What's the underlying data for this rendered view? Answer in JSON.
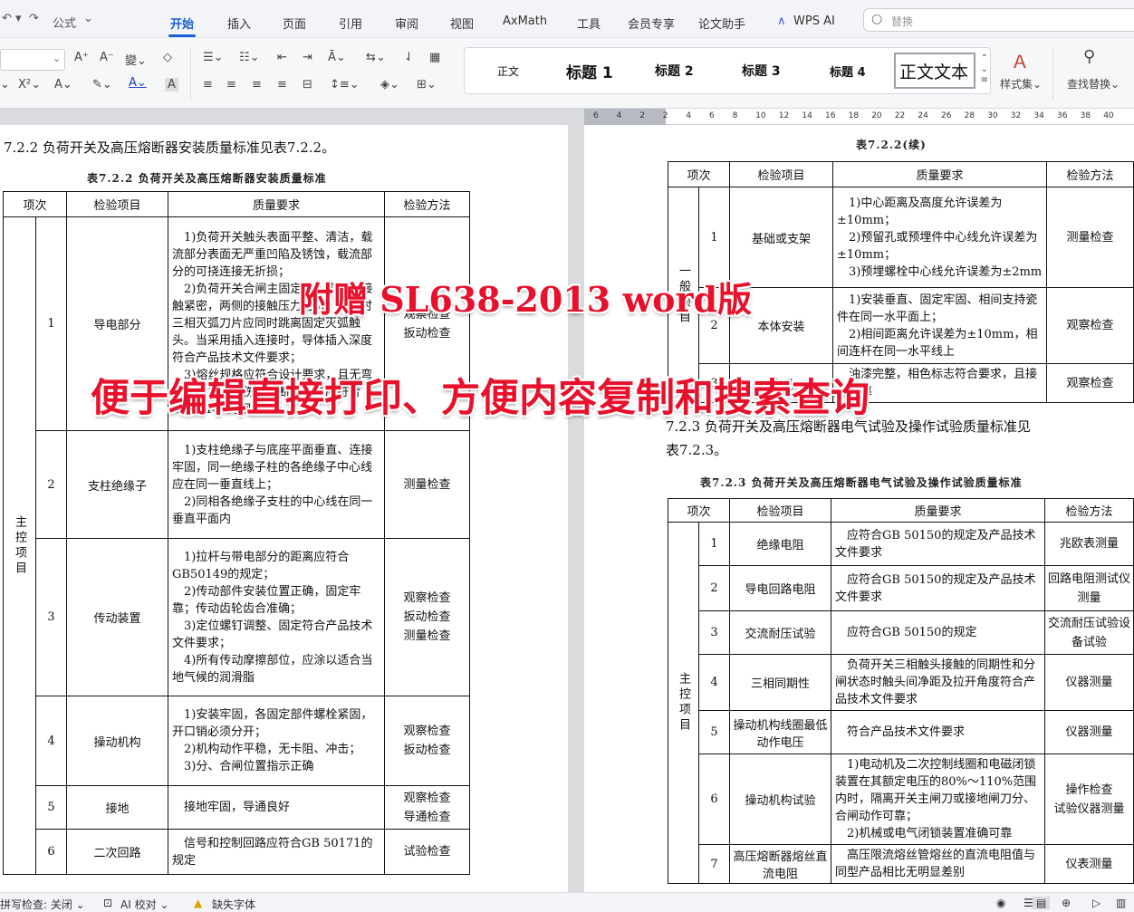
{
  "quick_access": {
    "undo_label": "公式"
  },
  "tabs": [
    "开始",
    "插入",
    "页面",
    "引用",
    "审阅",
    "视图",
    "AxMath",
    "工具",
    "会员专享",
    "论文助手",
    "WPS AI"
  ],
  "search": {
    "placeholder": "替换"
  },
  "ribbon": {
    "styles": [
      "正文",
      "标题 1",
      "标题 2",
      "标题 3",
      "标题 4",
      "正文文本"
    ],
    "style_set_label": "样式集",
    "find_replace_label": "查找替换"
  },
  "ruler": {
    "ticks": [
      "6",
      "4",
      "2",
      "2",
      "4",
      "6",
      "8",
      "10",
      "12",
      "14",
      "16",
      "18",
      "20",
      "22",
      "24",
      "26",
      "28",
      "30",
      "32",
      "34",
      "36",
      "38",
      "40"
    ]
  },
  "page1": {
    "section_heading": "7.2.2    负荷开关及高压熔断器安装质量标准见表7.2.2。",
    "table_caption": "表7.2.2   负荷开关及高压熔断器安装质量标准",
    "headers": [
      "项次",
      "检验项目",
      "质量要求",
      "检验方法"
    ],
    "group_label": "主控项目",
    "rows": [
      {
        "no": "1",
        "item": "导电部分",
        "req": [
          "1)负荷开关触头表面平整、清洁，载流部分表面无严重凹陷及锈蚀，载流部分的可挠连接无折损；",
          "2)负荷开关合闸主固定触头应可靠接触紧密，两侧的接触压力均匀；分闸时三相灭弧刀片应同时跳离固定灭弧触头。当采用插入连接时，导体插入深度符合产品技术文件要求；",
          "3)熔丝规格应符合设计要求，且无弯折、压扁或损伤，熔断器性能应符合GB50149的规定"
        ],
        "method": "观察检查\n扳动检查"
      },
      {
        "no": "2",
        "item": "支柱绝缘子",
        "req": [
          "1)支柱绝缘子与底座平面垂直、连接牢固，同一绝缘子柱的各绝缘子中心线应在同一垂直线上；",
          "2)同相各绝缘子支柱的中心线在同一垂直平面内"
        ],
        "method": "测量检查"
      },
      {
        "no": "3",
        "item": "传动装置",
        "req": [
          "1)拉杆与带电部分的距离应符合GB50149的规定；",
          "2)传动部件安装位置正确，固定牢靠；传动齿轮齿合准确；",
          "3)定位螺钉调整、固定符合产品技术文件要求；",
          "4)所有传动摩擦部位，应涂以适合当地气候的润滑脂"
        ],
        "method": "观察检查\n扳动检查\n测量检查"
      },
      {
        "no": "4",
        "item": "操动机构",
        "req": [
          "1)安装牢固，各固定部件螺栓紧固，开口销必须分开；",
          "2)机构动作平稳，无卡阻、冲击；",
          "3)分、合闸位置指示正确"
        ],
        "method": "观察检查\n扳动检查"
      },
      {
        "no": "5",
        "item": "接地",
        "req": [
          "接地牢固，导通良好"
        ],
        "method": "观察检查\n导通检查"
      },
      {
        "no": "6",
        "item": "二次回路",
        "req": [
          "信号和控制回路应符合GB 50171的规定"
        ],
        "method": "试验检查"
      }
    ]
  },
  "page2": {
    "cont_caption": "表7.2.2(续)",
    "headers": [
      "项次",
      "检验项目",
      "质量要求",
      "检验方法"
    ],
    "cont_group_label": "一般项目",
    "cont_rows": [
      {
        "no": "1",
        "item": "基础或支架",
        "req": [
          "1)中心距离及高度允许误差为±10mm；",
          "2)预留孔或预埋件中心线允许误差为±10mm；",
          "3)预埋螺栓中心线允许误差为±2mm"
        ],
        "method": "测量检查"
      },
      {
        "no": "2",
        "item": "本体安装",
        "req": [
          "1)安装垂直、固定牢固、相间支持瓷件在同一水平面上；",
          "2)相间距离允许误差为±10mm，相间连杆在同一水平线上"
        ],
        "method": "观察检查"
      },
      {
        "no": "3",
        "item": "外观",
        "req": [
          "油漆完整，相色标志符合要求，且接地可靠"
        ],
        "method": "观察检查"
      }
    ],
    "section_heading_1": "7.2.3    负荷开关及高压熔断器电气试验及操作试验质量标准见",
    "section_heading_2": "表7.2.3。",
    "table_caption": "表7.2.3   负荷开关及高压熔断器电气试验及操作试验质量标准",
    "group_label": "主控项目",
    "rows": [
      {
        "no": "1",
        "item": "绝缘电阻",
        "req": [
          "应符合GB 50150的规定及产品技术文件要求"
        ],
        "method": "兆欧表测量"
      },
      {
        "no": "2",
        "item": "导电回路电阻",
        "req": [
          "应符合GB 50150的规定及产品技术文件要求"
        ],
        "method": "回路电阻测试仪测量"
      },
      {
        "no": "3",
        "item": "交流耐压试验",
        "req": [
          "应符合GB 50150的规定"
        ],
        "method": "交流耐压试验设备试验"
      },
      {
        "no": "4",
        "item": "三相同期性",
        "req": [
          "负荷开关三相触头接触的同期性和分闸状态时触头间净距及拉开角度符合产品技术文件要求"
        ],
        "method": "仪器测量"
      },
      {
        "no": "5",
        "item": "操动机构线圈最低动作电压",
        "req": [
          "符合产品技术文件要求"
        ],
        "method": "仪器测量"
      },
      {
        "no": "6",
        "item": "操动机构试验",
        "req": [
          "1)电动机及二次控制线圈和电磁闭锁装置在其额定电压的80%～110%范围内时，隔离开关主闸刀或接地闸刀分、合闸动作可靠；",
          "2)机械或电气闭锁装置准确可靠"
        ],
        "method": "操作检查\n试验仪器测量"
      },
      {
        "no": "7",
        "item": "高压熔断器熔丝直流电阻",
        "req": [
          "高压限流熔丝管熔丝的直流电阻值与同型产品相比无明显差别"
        ],
        "method": "仪表测量"
      }
    ]
  },
  "overlay": {
    "line1": "附赠 SL638-2013 word版",
    "line2": "便于编辑直接打印、方便内容复制和搜索查询"
  },
  "status": {
    "spellcheck": "拼写检查: 关闭",
    "ai_check": "AI 校对",
    "missing_font": "缺失字体"
  },
  "colors": {
    "accent": "#1a5fd6",
    "banner": "#e8102a"
  }
}
